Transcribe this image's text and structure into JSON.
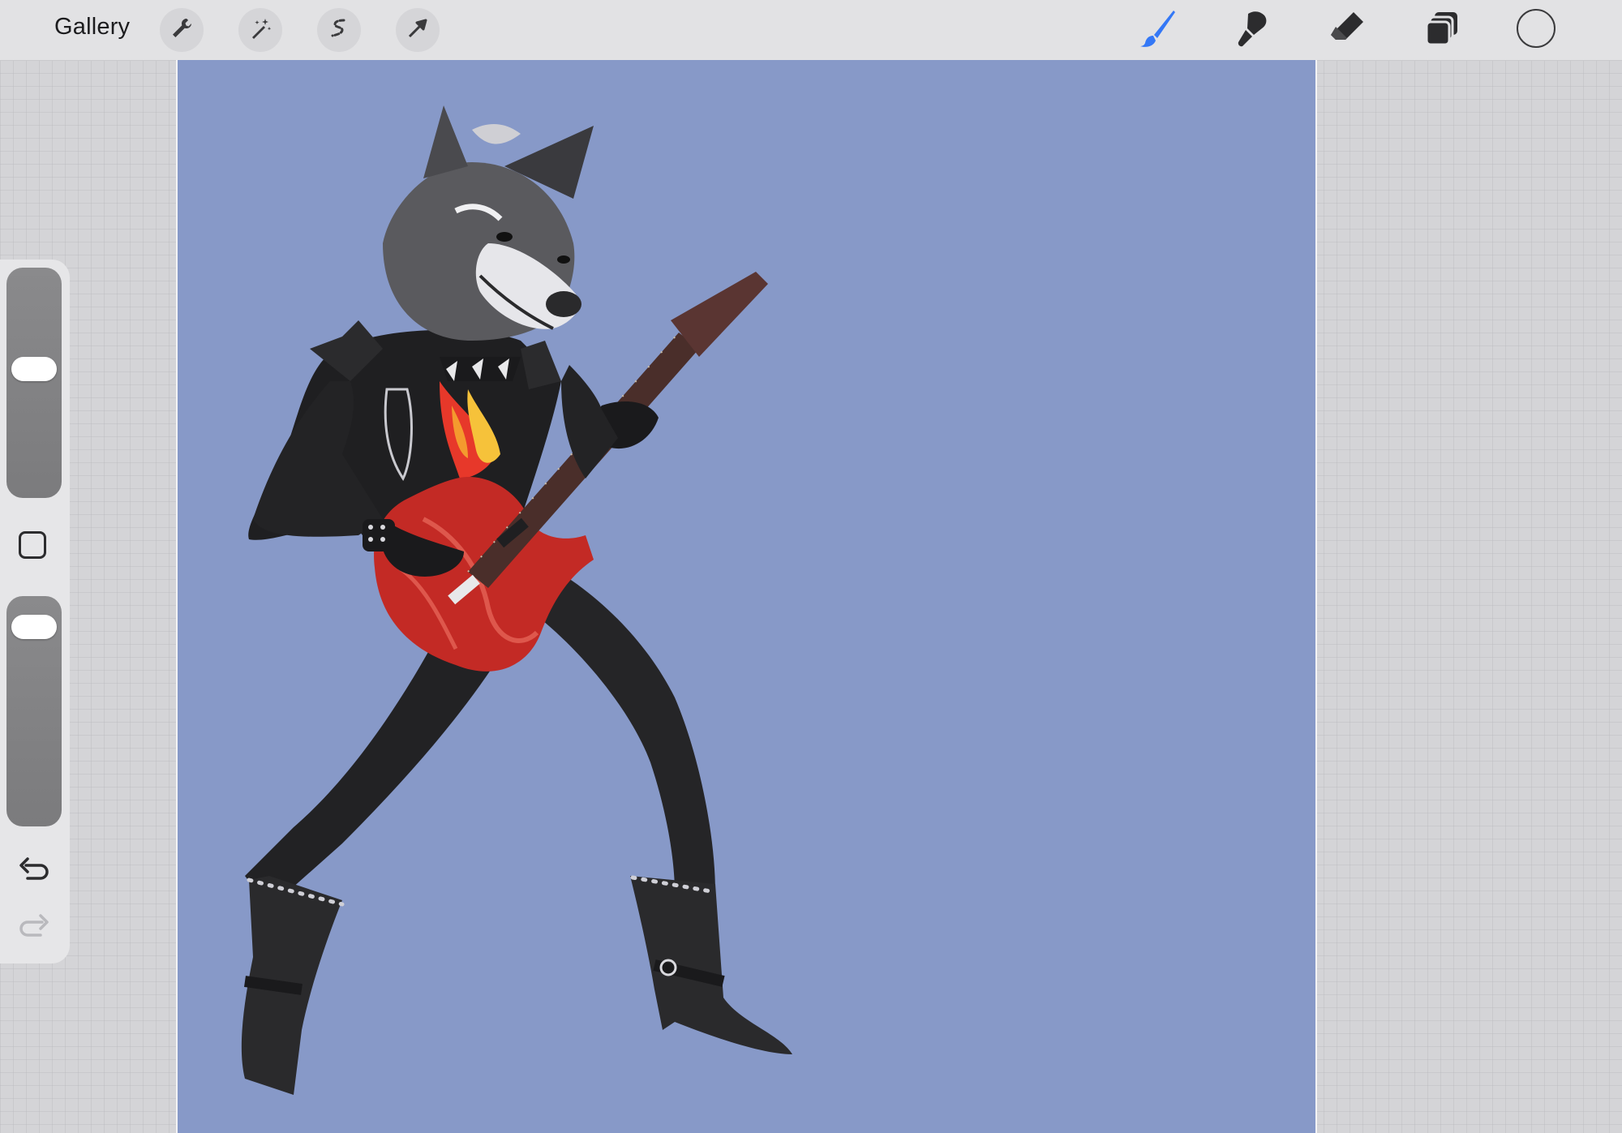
{
  "topbar": {
    "gallery_label": "Gallery",
    "left_tools": [
      "wrench-icon",
      "magic-wand-icon",
      "selection-s-icon",
      "transform-arrow-icon"
    ],
    "right_tools": [
      "brush-icon",
      "smudge-icon",
      "eraser-icon",
      "layers-icon"
    ],
    "active_tool": "brush-icon",
    "active_color": "#3478f6",
    "current_color": "#e2e2e4"
  },
  "canvas": {
    "background_color": "#8799c8",
    "artwork": "wolf-guitarist"
  },
  "sidebar": {
    "brush_size_level": 0.43,
    "opacity_level": 0.07,
    "controls": [
      "brush-size-slider",
      "modify-button",
      "opacity-slider",
      "undo-icon",
      "redo-icon"
    ]
  }
}
